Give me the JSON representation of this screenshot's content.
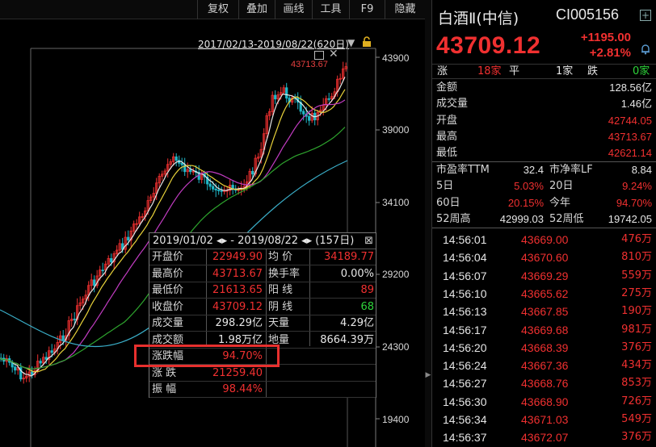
{
  "toolbar": {
    "buttons": [
      "复权",
      "叠加",
      "画线",
      "工具",
      "F9",
      "隐藏"
    ]
  },
  "chart": {
    "range_label": "2017/02/13-2019/08/22(620日)",
    "high_label": "43713.67",
    "y_ticks": [
      "43900",
      "39000",
      "34100",
      "29200",
      "24300",
      "19400"
    ]
  },
  "stats": {
    "header": "2019/01/02 ◂▸ - 2019/08/22 ◂▸ (157日)",
    "close_label": "⊠",
    "rows": [
      {
        "l1": "开盘价",
        "v1": "22949.90",
        "l2": "均  价",
        "v2": "34189.77",
        "c1": "red",
        "c2": "red"
      },
      {
        "l1": "最高价",
        "v1": "43713.67",
        "l2": "换手率",
        "v2": "0.00%",
        "c1": "red",
        "c2": "white"
      },
      {
        "l1": "最低价",
        "v1": "21613.65",
        "l2": "阳  线",
        "v2": "89",
        "c1": "red",
        "c2": "red"
      },
      {
        "l1": "收盘价",
        "v1": "43709.12",
        "l2": "阴  线",
        "v2": "68",
        "c1": "red",
        "c2": "green"
      },
      {
        "l1": "成交量",
        "v1": "298.29亿",
        "l2": "天量",
        "v2": "4.29亿",
        "c1": "white",
        "c2": "white"
      },
      {
        "l1": "成交额",
        "v1": "1.98万亿",
        "l2": "地量",
        "v2": "8664.39万",
        "c1": "white",
        "c2": "white"
      },
      {
        "l1": "涨跌幅",
        "v1": "94.70%",
        "l2": "",
        "v2": "",
        "c1": "red",
        "c2": "white"
      },
      {
        "l1": "涨  跌",
        "v1": "21259.40",
        "l2": "",
        "v2": "",
        "c1": "red",
        "c2": "white"
      },
      {
        "l1": "振  幅",
        "v1": "98.44%",
        "l2": "",
        "v2": "",
        "c1": "red",
        "c2": "white"
      }
    ]
  },
  "quote": {
    "name": "白酒Ⅱ(中信)",
    "code": "CI005156",
    "price": "43709.12",
    "change": "+1195.00",
    "change_pct": "+2.81%",
    "adv_label": "涨",
    "adv_count": "18家",
    "flat_label": "平",
    "flat_count": "1家",
    "dec_label": "跌",
    "dec_count": "0家",
    "rows": [
      {
        "label": "金额",
        "value": "128.56亿",
        "color": "white"
      },
      {
        "label": "成交量",
        "value": "1.46亿",
        "color": "white"
      },
      {
        "label": "开盘",
        "value": "42744.05",
        "color": "red"
      },
      {
        "label": "最高",
        "value": "43713.67",
        "color": "red"
      },
      {
        "label": "最低",
        "value": "42621.14",
        "color": "red"
      }
    ],
    "metrics": [
      {
        "l1": "市盈率TTM",
        "v1": "32.4",
        "l2": "市净率LF",
        "v2": "8.84",
        "c1": "white",
        "c2": "white"
      },
      {
        "l1": "5日",
        "v1": "5.03%",
        "l2": "20日",
        "v2": "9.24%",
        "c1": "red",
        "c2": "red"
      },
      {
        "l1": "60日",
        "v1": "20.15%",
        "l2": "今年",
        "v2": "94.70%",
        "c1": "red",
        "c2": "red"
      },
      {
        "l1": "52周高",
        "v1": "42999.03",
        "l2": "52周低",
        "v2": "19742.05",
        "c1": "white",
        "c2": "white"
      }
    ]
  },
  "ticks": [
    {
      "time": "14:56:01",
      "price": "43669.00",
      "vol": "476万"
    },
    {
      "time": "14:56:04",
      "price": "43670.60",
      "vol": "810万"
    },
    {
      "time": "14:56:07",
      "price": "43669.29",
      "vol": "559万"
    },
    {
      "time": "14:56:10",
      "price": "43665.62",
      "vol": "275万"
    },
    {
      "time": "14:56:13",
      "price": "43667.85",
      "vol": "190万"
    },
    {
      "time": "14:56:17",
      "price": "43669.68",
      "vol": "981万"
    },
    {
      "time": "14:56:20",
      "price": "43668.39",
      "vol": "376万"
    },
    {
      "time": "14:56:24",
      "price": "43667.36",
      "vol": "434万"
    },
    {
      "time": "14:56:27",
      "price": "43668.76",
      "vol": "853万"
    },
    {
      "time": "14:56:30",
      "price": "43668.90",
      "vol": "726万"
    },
    {
      "time": "14:56:34",
      "price": "43671.03",
      "vol": "549万"
    },
    {
      "time": "14:56:37",
      "price": "43672.07",
      "vol": "376万"
    }
  ],
  "colors": {
    "up": "#f03030",
    "down": "#2ed43a",
    "ma5": "#e8e8e8",
    "ma10": "#e8d23a",
    "ma20": "#c23cc2",
    "ma60": "#2ea52e",
    "ma120": "#3aaec8"
  }
}
